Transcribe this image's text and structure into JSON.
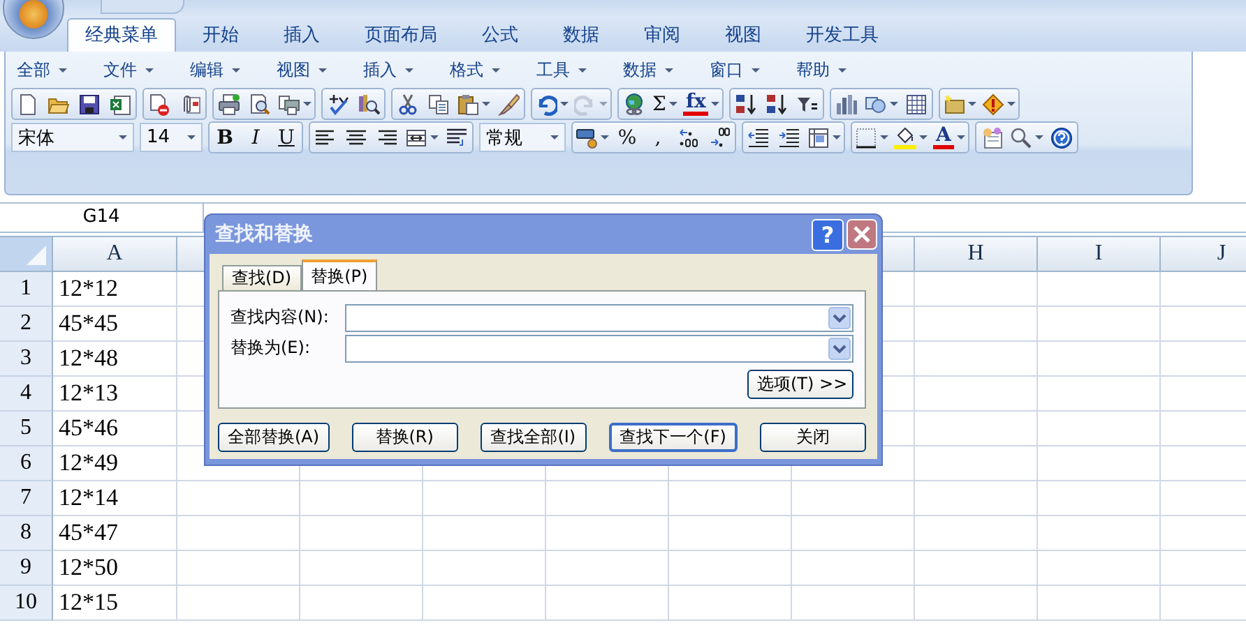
{
  "ribbon_tabs": [
    {
      "label": "经典菜单",
      "selected": true
    },
    {
      "label": "开始",
      "selected": false
    },
    {
      "label": "插入",
      "selected": false
    },
    {
      "label": "页面布局",
      "selected": false
    },
    {
      "label": "公式",
      "selected": false
    },
    {
      "label": "数据",
      "selected": false
    },
    {
      "label": "审阅",
      "selected": false
    },
    {
      "label": "视图",
      "selected": false
    },
    {
      "label": "开发工具",
      "selected": false
    }
  ],
  "menus": [
    "全部",
    "文件",
    "编辑",
    "视图",
    "插入",
    "格式",
    "工具",
    "数据",
    "窗口",
    "帮助"
  ],
  "toolbars": [
    {
      "groups": [
        {
          "items": [
            {
              "kind": "icon",
              "dropdown": false,
              "disabled": false
            },
            {
              "kind": "icon",
              "dropdown": false,
              "disabled": false
            },
            {
              "kind": "icon",
              "dropdown": false,
              "disabled": false
            },
            {
              "kind": "icon",
              "dropdown": false,
              "disabled": false
            }
          ]
        },
        {
          "items": [
            {
              "kind": "icon",
              "dropdown": false,
              "disabled": false
            },
            {
              "kind": "icon",
              "dropdown": false,
              "disabled": false
            }
          ]
        },
        {
          "items": [
            {
              "kind": "icon",
              "dropdown": false,
              "disabled": false
            },
            {
              "kind": "icon",
              "dropdown": false,
              "disabled": false
            },
            {
              "kind": "icon",
              "dropdown": true,
              "disabled": false
            }
          ]
        },
        {
          "items": [
            {
              "kind": "icon",
              "dropdown": false,
              "disabled": false
            },
            {
              "kind": "icon",
              "dropdown": false,
              "disabled": false
            }
          ]
        },
        {
          "items": [
            {
              "kind": "icon",
              "dropdown": false,
              "disabled": false
            },
            {
              "kind": "icon",
              "dropdown": false,
              "disabled": false
            },
            {
              "kind": "icon",
              "dropdown": true,
              "disabled": false
            },
            {
              "kind": "icon",
              "dropdown": false,
              "disabled": false
            }
          ]
        },
        {
          "items": [
            {
              "kind": "icon",
              "dropdown": true,
              "disabled": false
            },
            {
              "kind": "icon",
              "dropdown": true,
              "disabled": true
            }
          ]
        },
        {
          "items": [
            {
              "kind": "icon",
              "dropdown": false,
              "disabled": false
            },
            {
              "kind": "text",
              "label": "Σ",
              "dropdown": true,
              "disabled": false
            },
            {
              "kind": "text",
              "label": "fx",
              "dropdown": true,
              "disabled": false
            }
          ]
        },
        {
          "items": [
            {
              "kind": "icon",
              "dropdown": false,
              "disabled": false
            },
            {
              "kind": "icon",
              "dropdown": false,
              "disabled": false
            },
            {
              "kind": "icon",
              "dropdown": false,
              "disabled": false
            }
          ]
        },
        {
          "items": [
            {
              "kind": "icon",
              "dropdown": false,
              "disabled": false
            },
            {
              "kind": "icon",
              "dropdown": true,
              "disabled": false
            },
            {
              "kind": "icon",
              "dropdown": false,
              "disabled": false
            }
          ]
        },
        {
          "items": [
            {
              "kind": "icon",
              "dropdown": true,
              "disabled": false
            },
            {
              "kind": "icon",
              "dropdown": true,
              "disabled": false
            }
          ]
        }
      ]
    },
    {
      "groups": [
        {
          "combo": "宋体"
        },
        {
          "combo": "14"
        },
        {
          "items": [
            {
              "kind": "text",
              "label": "B",
              "dropdown": false,
              "disabled": false
            },
            {
              "kind": "text",
              "label": "I",
              "dropdown": false,
              "disabled": false
            },
            {
              "kind": "text",
              "label": "U",
              "dropdown": false,
              "disabled": false
            }
          ]
        },
        {
          "items": [
            {
              "kind": "icon",
              "dropdown": false,
              "disabled": false
            },
            {
              "kind": "icon",
              "dropdown": false,
              "disabled": false
            },
            {
              "kind": "icon",
              "dropdown": false,
              "disabled": false
            },
            {
              "kind": "icon",
              "dropdown": true,
              "disabled": false
            },
            {
              "kind": "icon",
              "dropdown": false,
              "disabled": false
            }
          ]
        },
        {
          "combo": "常规"
        },
        {
          "items": [
            {
              "kind": "icon",
              "dropdown": true,
              "disabled": false
            },
            {
              "kind": "text",
              "label": "%",
              "dropdown": false,
              "disabled": false
            },
            {
              "kind": "text",
              "label": ",",
              "dropdown": false,
              "disabled": false
            },
            {
              "kind": "icon",
              "dropdown": false,
              "disabled": false
            },
            {
              "kind": "icon",
              "dropdown": false,
              "disabled": false
            }
          ]
        },
        {
          "items": [
            {
              "kind": "icon",
              "dropdown": false,
              "disabled": false
            },
            {
              "kind": "icon",
              "dropdown": false,
              "disabled": false
            },
            {
              "kind": "icon",
              "dropdown": true,
              "disabled": false
            }
          ]
        },
        {
          "items": [
            {
              "kind": "icon",
              "dropdown": true,
              "disabled": false
            },
            {
              "kind": "icon",
              "dropdown": true,
              "disabled": false
            },
            {
              "kind": "text",
              "label": "A",
              "dropdown": true,
              "disabled": false
            }
          ]
        },
        {
          "items": [
            {
              "kind": "icon",
              "dropdown": false,
              "disabled": false
            },
            {
              "kind": "icon",
              "dropdown": true,
              "disabled": false
            },
            {
              "kind": "icon",
              "dropdown": false,
              "disabled": false
            }
          ]
        }
      ]
    }
  ],
  "name_box": "G14",
  "sheet": {
    "columns": [
      "A",
      "H",
      "I",
      "J"
    ],
    "rows": [
      {
        "number": "1",
        "cells": [
          "12*12"
        ]
      },
      {
        "number": "2",
        "cells": [
          "45*45"
        ]
      },
      {
        "number": "3",
        "cells": [
          "12*48"
        ]
      },
      {
        "number": "4",
        "cells": [
          "12*13"
        ]
      },
      {
        "number": "5",
        "cells": [
          "45*46"
        ]
      },
      {
        "number": "6",
        "cells": [
          "12*49"
        ]
      },
      {
        "number": "7",
        "cells": [
          "12*14"
        ]
      },
      {
        "number": "8",
        "cells": [
          "45*47"
        ]
      },
      {
        "number": "9",
        "cells": [
          "12*50"
        ]
      },
      {
        "number": "10",
        "cells": [
          "12*15"
        ]
      }
    ]
  },
  "dialog": {
    "title": "查找和替换",
    "help": "?",
    "tabs": [
      {
        "label": "查找(D)",
        "selected": false
      },
      {
        "label": "替换(P)",
        "selected": true
      }
    ],
    "fields": [
      {
        "label": "查找内容(N):"
      },
      {
        "label": "替换为(E):"
      }
    ],
    "options_button": "选项(T) >>",
    "buttons": [
      {
        "label": "全部替换(A)",
        "default": false
      },
      {
        "label": "替换(R)",
        "default": false
      },
      {
        "label": "查找全部(I)",
        "default": false
      },
      {
        "label": "查找下一个(F)",
        "default": true
      },
      {
        "label": "关闭",
        "default": false
      }
    ]
  }
}
